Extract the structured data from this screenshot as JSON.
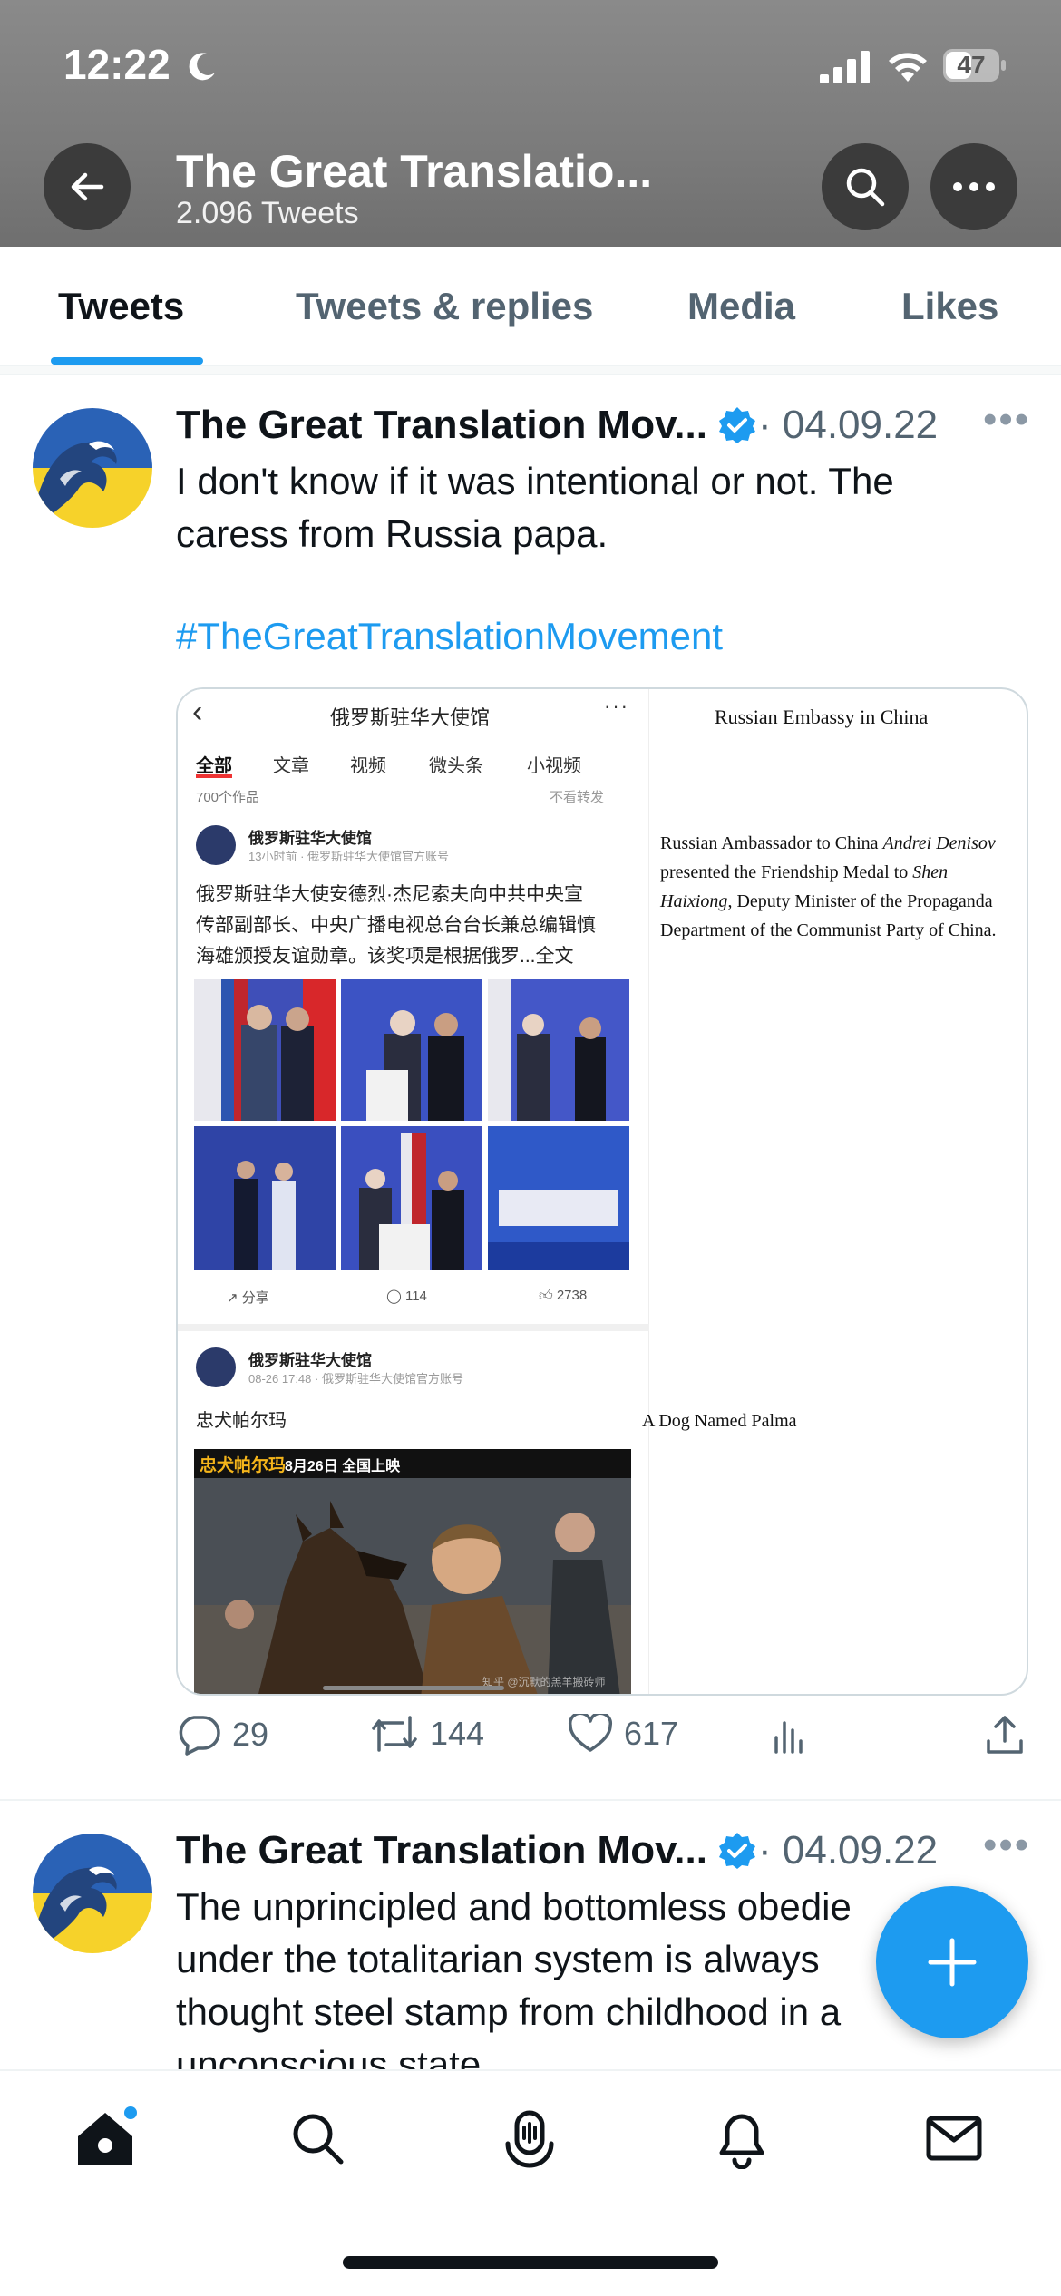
{
  "status_bar": {
    "time": "12:22",
    "battery": "47"
  },
  "header": {
    "title": "The Great Translatio...",
    "subtitle": "2.096 Tweets"
  },
  "tabs": [
    {
      "label": "Tweets",
      "active": true
    },
    {
      "label": "Tweets & replies",
      "active": false
    },
    {
      "label": "Media",
      "active": false
    },
    {
      "label": "Likes",
      "active": false
    }
  ],
  "tweets": [
    {
      "author": "The Great Translation Mov...",
      "date": "· 04.09.22",
      "text_line1": "I don't know if it was intentional or not. The",
      "text_line2": "caress from Russia papa.",
      "hashtag": "#TheGreatTranslationMovement",
      "image": {
        "left_header": "俄罗斯驻华大使馆",
        "left_tabs": [
          "全部",
          "文章",
          "视频",
          "微头条",
          "小视频"
        ],
        "works_count": "700个作品",
        "no_repost": "不看转发",
        "post1_account": "俄罗斯驻华大使馆",
        "post1_meta": "13小时前 · 俄罗斯驻华大使馆官方账号",
        "post1_text1": "俄罗斯驻华大使安德烈·杰尼索夫向中共中央宣",
        "post1_text2": "传部副部长、中央广播电视总台台长兼总编辑慎",
        "post1_text3": "海雄颁授友谊勋章。该奖项是根据俄罗...全文",
        "share": "分享",
        "comments": "114",
        "likes": "2738",
        "post2_account": "俄罗斯驻华大使馆",
        "post2_meta": "08-26 17:48 · 俄罗斯驻华大使馆官方账号",
        "post2_text": "忠犬帕尔玛",
        "banner_title": "忠犬帕尔玛",
        "banner_sub": "8月26日 全国上映",
        "watermark": "知乎 @沉默的羔羊搬砖师",
        "right_title": "Russian Embassy in China",
        "right_caption_a": "Russian Ambassador to China ",
        "right_caption_name1": "Andrei Denisov",
        "right_caption_b": " presented the Friendship Medal to ",
        "right_caption_name2": "Shen Haixiong",
        "right_caption_c": ", Deputy Minister of the Propaganda Department of the Communist Party of China.",
        "right_dog": "A Dog Named Palma"
      },
      "stats": {
        "replies": "29",
        "retweets": "144",
        "likes": "617"
      }
    },
    {
      "author": "The Great Translation Mov...",
      "date": "· 04.09.22",
      "text_line1": "The unprincipled and bottomless obedie",
      "text_line2": "under the totalitarian system is always",
      "text_line3": "thought steel stamp from childhood in a",
      "text_line4": "unconscious state"
    }
  ],
  "colors": {
    "accent": "#1d9bf0",
    "text": "#0f1419",
    "muted": "#536471"
  }
}
